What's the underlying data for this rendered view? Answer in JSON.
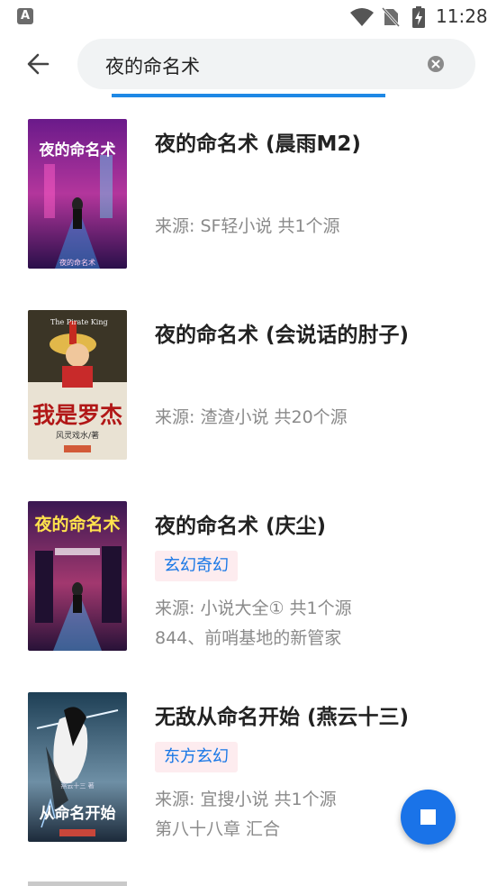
{
  "status": {
    "time": "11:28",
    "app_icon_letter": "A"
  },
  "search": {
    "query": "夜的命名术"
  },
  "results": [
    {
      "title": "夜的命名术 (晨雨M2)",
      "tag": "",
      "source": "来源: SF轻小说  共1个源",
      "latest": "",
      "cover_text": "夜的命名术",
      "cover_sub": "夜的命名术"
    },
    {
      "title": "夜的命名术 (会说话的肘子)",
      "tag": "",
      "source": "来源: 渣渣小说  共20个源",
      "latest": "",
      "cover_text": "我是罗杰",
      "cover_sub": "风灵戏水/著",
      "cover_top": "The Pirate King"
    },
    {
      "title": "夜的命名术 (庆尘)",
      "tag": "玄幻奇幻",
      "source": "来源: 小说大全①  共1个源",
      "latest": "844、前哨基地的新管家",
      "cover_text": "夜的命名术"
    },
    {
      "title": "无敌从命名开始 (燕云十三)",
      "tag": "东方玄幻",
      "source": "来源: 宜搜小说  共1个源",
      "latest": "第八十八章 汇合",
      "cover_text": "从命名开始",
      "cover_sub": "燕云十三 著"
    }
  ]
}
